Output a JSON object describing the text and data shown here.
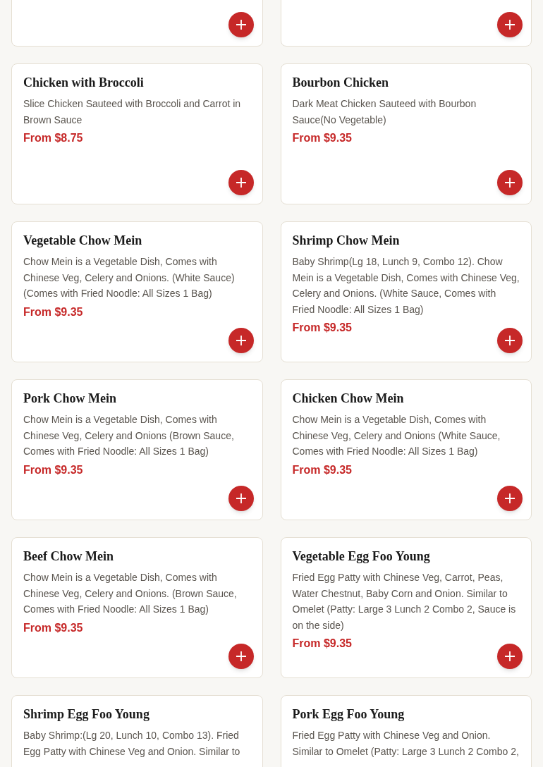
{
  "items": [
    {
      "kind": "partial"
    },
    {
      "kind": "partial"
    },
    {
      "kind": "full",
      "name": "Chicken with Broccoli",
      "description": "Slice Chicken Sauteed with Broccoli and Carrot in Brown Sauce",
      "price": "From $8.75"
    },
    {
      "kind": "full",
      "name": "Bourbon Chicken",
      "description": "Dark Meat Chicken Sauteed with Bourbon Sauce(No Vegetable)",
      "price": "From $9.35"
    },
    {
      "kind": "full",
      "name": "Vegetable Chow Mein",
      "description": "Chow Mein is a Vegetable Dish, Comes with Chinese Veg, Celery and Onions. (White Sauce) (Comes with Fried Noodle: All Sizes 1 Bag)",
      "price": "From $9.35"
    },
    {
      "kind": "full",
      "name": "Shrimp Chow Mein",
      "description": "Baby Shrimp(Lg 18, Lunch 9, Combo 12). Chow Mein is a Vegetable Dish, Comes with Chinese Veg, Celery and Onions. (White Sauce, Comes with Fried Noodle: All Sizes 1 Bag)",
      "price": "From $9.35"
    },
    {
      "kind": "full",
      "name": "Pork Chow Mein",
      "description": "Chow Mein is a Vegetable Dish, Comes with Chinese Veg, Celery and Onions (Brown Sauce, Comes with Fried Noodle: All Sizes 1 Bag)",
      "price": "From $9.35"
    },
    {
      "kind": "full",
      "name": "Chicken Chow Mein",
      "description": "Chow Mein is a Vegetable Dish, Comes with Chinese Veg, Celery and Onions (White Sauce, Comes with Fried Noodle: All Sizes 1 Bag)",
      "price": "From $9.35"
    },
    {
      "kind": "full",
      "name": "Beef Chow Mein",
      "description": "Chow Mein is a Vegetable Dish, Comes with Chinese Veg, Celery and Onions. (Brown Sauce, Comes with Fried Noodle: All Sizes 1 Bag)",
      "price": "From $9.35"
    },
    {
      "kind": "full",
      "name": "Vegetable Egg Foo Young",
      "description": "Fried Egg Patty with Chinese Veg, Carrot, Peas, Water Chestnut, Baby Corn and Onion. Similar to Omelet (Patty: Large 3 Lunch 2 Combo 2, Sauce is on the side)",
      "price": "From $9.35"
    },
    {
      "kind": "full",
      "name": "Shrimp Egg Foo Young",
      "description": "Baby Shrimp:(Lg 20, Lunch 10, Combo 13). Fried Egg Patty with Chinese Veg and Onion. Similar to"
    },
    {
      "kind": "full",
      "name": "Pork Egg Foo Young",
      "description": "Fried Egg Patty with Chinese Veg and Onion. Similar to Omelet (Patty: Large 3 Lunch 2 Combo 2,"
    }
  ]
}
